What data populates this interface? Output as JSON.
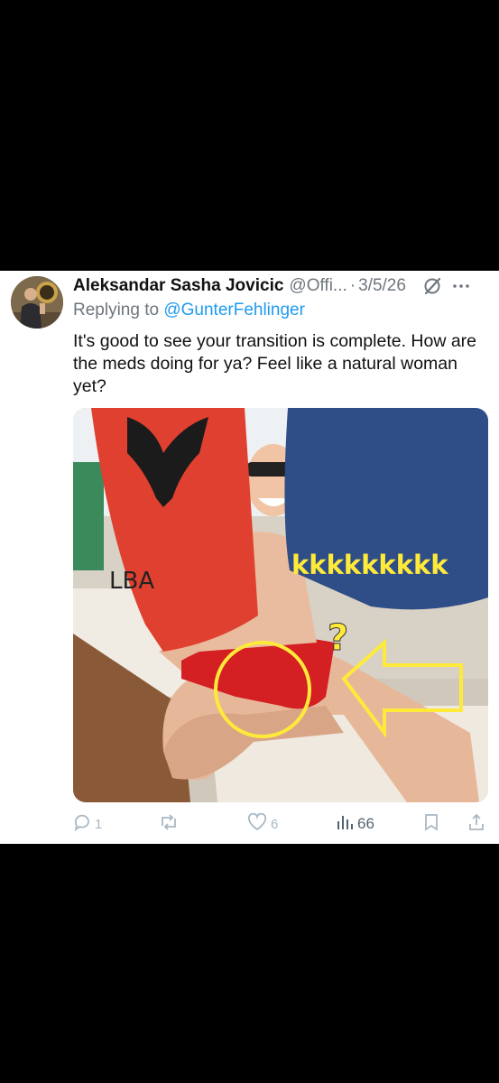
{
  "tweet": {
    "display_name": "Aleksandar Sasha Jovicic",
    "handle": "@Offi...",
    "separator": "·",
    "date": "3/5/26",
    "replying_prefix": "Replying to",
    "replying_to": "@GunterFehlinger",
    "text": "It's good to see your transition is complete. How are the meds doing for ya? Feel like a natural woman yet?",
    "media": {
      "overlay_text": "kkkkkkkkk",
      "towel_left_text": "LBA",
      "question_mark": "?"
    }
  },
  "actions": {
    "replies": "1",
    "reposts": "",
    "likes": "6",
    "views": "66"
  },
  "icons": [
    "grok-icon",
    "more-icon",
    "reply-icon",
    "repost-icon",
    "like-icon",
    "views-icon",
    "bookmark-icon",
    "share-icon"
  ],
  "colors": {
    "link": "#1d9bf0",
    "muted": "#6e767d",
    "overlay_yellow": "#ffea3a"
  }
}
